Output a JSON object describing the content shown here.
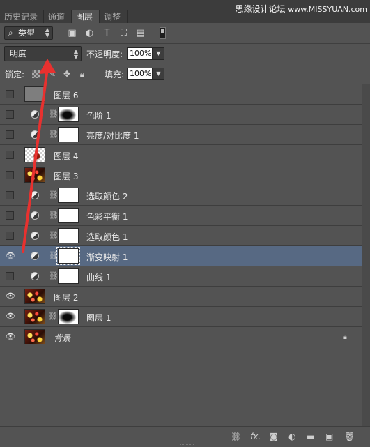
{
  "tabs": [
    "历史记录",
    "通道",
    "图层",
    "调整"
  ],
  "active_tab": 2,
  "watermark": {
    "text": "思缘设计论坛",
    "site": "www.MISSYUAN.com"
  },
  "filter": {
    "label": "类型"
  },
  "filter_icons": [
    "image-filter-icon",
    "adjustment-filter-icon",
    "type-filter-icon",
    "shape-filter-icon",
    "smart-object-filter-icon"
  ],
  "blend_mode": "明度",
  "opacity": {
    "label": "不透明度:",
    "value": "100%"
  },
  "lock": {
    "label": "锁定:"
  },
  "fill": {
    "label": "填充:",
    "value": "100%"
  },
  "layers": [
    {
      "name": "图层 6",
      "visible": false,
      "type": "pixel",
      "thumb": "gray"
    },
    {
      "name": "色阶 1",
      "visible": false,
      "type": "adjustment",
      "mask": "mask"
    },
    {
      "name": "亮度/对比度 1",
      "visible": false,
      "type": "adjustment",
      "mask": "white"
    },
    {
      "name": "图层 4",
      "visible": false,
      "type": "pixel",
      "thumb": "checker"
    },
    {
      "name": "图层 3",
      "visible": false,
      "type": "pixel",
      "thumb": "photo"
    },
    {
      "name": "选取颜色 2",
      "visible": false,
      "type": "adjustment",
      "mask": "white"
    },
    {
      "name": "色彩平衡 1",
      "visible": false,
      "type": "adjustment",
      "mask": "white"
    },
    {
      "name": "选取颜色 1",
      "visible": false,
      "type": "adjustment",
      "mask": "white"
    },
    {
      "name": "渐变映射 1",
      "visible": true,
      "type": "adjustment",
      "mask": "white",
      "selected": true
    },
    {
      "name": "曲线 1",
      "visible": false,
      "type": "adjustment",
      "mask": "white"
    },
    {
      "name": "图层 2",
      "visible": true,
      "type": "pixel",
      "thumb": "photo"
    },
    {
      "name": "图层 1",
      "visible": true,
      "type": "pixel-mask",
      "thumb": "photo",
      "mask": "mask"
    },
    {
      "name": "背景",
      "visible": true,
      "type": "background",
      "thumb": "photo",
      "locked": true
    }
  ],
  "footer_icons": [
    "link-layers-icon",
    "layer-style-icon",
    "add-mask-icon",
    "new-adjustment-icon",
    "new-group-icon",
    "new-layer-icon",
    "delete-layer-icon"
  ],
  "annotation_color": "#e8312f"
}
